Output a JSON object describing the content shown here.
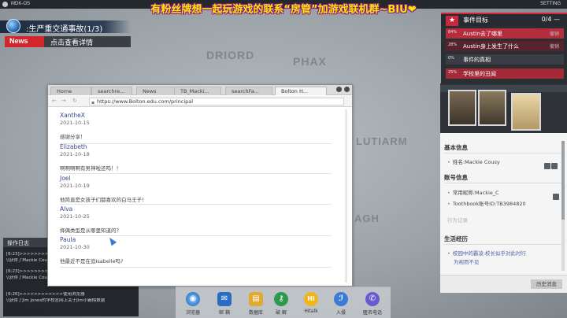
{
  "system": {
    "title": "MDK-OS",
    "settings_label": "SETTING"
  },
  "banner": "有粉丝牌想一起玩游戏的联系“房管”加游戏联机群~BIU❤",
  "map_labels": {
    "driord": "DRIORD",
    "phax": "PHAX",
    "lutiarm": "LUTIARM",
    "agh": "AGH"
  },
  "news": {
    "headline": ":生严重交通事故(1/3)",
    "tag": "News",
    "link": "点击查看详情"
  },
  "log": {
    "title": "操作日志",
    "lines": [
      "[6:23]>>>>>>>>>>>>使用浏览器",
      "\\\\获得了Mackie Cousy的Toothbook账号ID",
      "[6:23]>>>>>>>>>>>>使用浏览器",
      "\\\\获得了Mackie Cousy的Toothbook账号ID",
      "",
      "[6:26]>>>>>>>>>>>>使用浏览器",
      "\\\\获得了Jim Jones的学校官网上关于Jim小霸榜数据"
    ]
  },
  "browser": {
    "tabs": [
      "Home",
      "searchre...",
      "News",
      "TB_Macki...",
      "searchFa...",
      "Bolton H..."
    ],
    "url": "https://www.Bolton.edu.com/principal",
    "comments": [
      {
        "name": "XantheX",
        "date": "2021-10-15",
        "text": "感谢分享！"
      },
      {
        "name": "Elizabeth",
        "date": "2021-10-18",
        "text": "啊啊啊啊有男神啦还吗！！"
      },
      {
        "name": "Joel",
        "date": "2021-10-19",
        "text": "他简直是女孩子们都喜欢的白马王子！"
      },
      {
        "name": "Alva",
        "date": "2021-10-25",
        "text": "择偶类型是从哪里知道的？"
      },
      {
        "name": "Paula",
        "date": "2021-10-30",
        "text": "他最近不是在追Isabelle吗?"
      }
    ]
  },
  "objectives": {
    "title": "事件目标",
    "count": "0/4",
    "count_arrow": "—",
    "items": [
      {
        "pct": "84%",
        "label": "Austin去了哪里",
        "flag": "撤销"
      },
      {
        "pct": "28%",
        "label": "Austin身上发生了什么",
        "flag": "撤销"
      },
      {
        "pct": "0%",
        "label": "事件的真相",
        "flag": ""
      },
      {
        "pct": "25%",
        "label": "学校里的丑闻",
        "flag": ""
      }
    ]
  },
  "profile": {
    "basic_title": "基本信息",
    "name": "姓名:Mackie Cousy",
    "account_title": "账号信息",
    "nickname": "常用昵称:Mackie_C",
    "toothbook_id": "Toothbook账号ID:TB3984820",
    "hidden_item": "行为记录",
    "life_title": "生活经历",
    "life_item1": "校园中的霸凌:校长似乎对此时行",
    "life_item2": "为视而不见"
  },
  "history_button": "历史消息",
  "dock": {
    "apps": [
      {
        "label": "浏览器",
        "icon": "browser-icon"
      },
      {
        "label": "邮 箱",
        "icon": "mail-icon"
      },
      {
        "label": "数据库",
        "icon": "database-icon"
      },
      {
        "label": "破 解",
        "icon": "crack-icon"
      },
      {
        "label": "Hitalk",
        "icon": "hitalk-icon"
      },
      {
        "label": "入侵",
        "icon": "hack-icon"
      },
      {
        "label": "匿名电话",
        "icon": "phone-icon"
      }
    ]
  },
  "colors": {
    "accent_red": "#c8283c",
    "news_red": "#d3262b",
    "dark_panel": "#272b31"
  }
}
